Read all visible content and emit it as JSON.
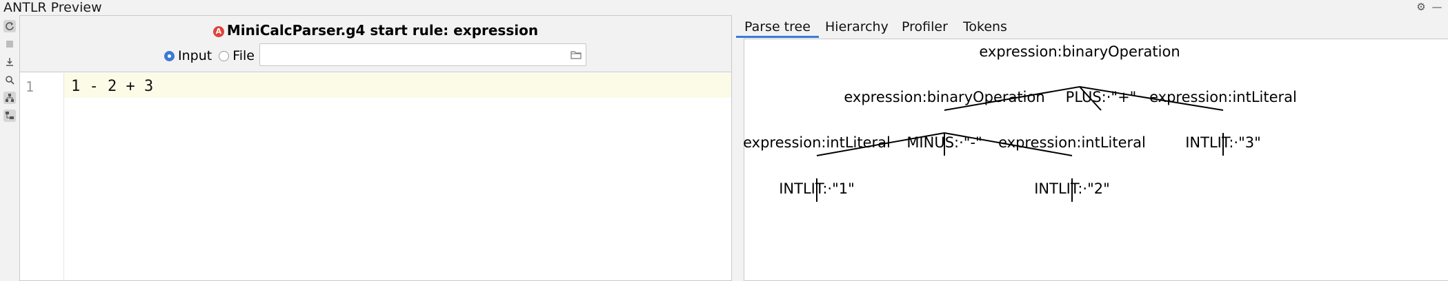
{
  "window": {
    "title": "ANTLR Preview",
    "title_icons": [
      "gear-icon",
      "minimize-icon"
    ]
  },
  "toolbar": {
    "tools": [
      "refresh-icon",
      "stop-icon",
      "export-icon",
      "find-icon",
      "tree-icon",
      "hierarchy-icon"
    ]
  },
  "header": {
    "grammar": "MiniCalcParser.g4 start rule: expression",
    "status_icon": "A",
    "input_label": "Input",
    "file_label": "File",
    "file_path": ""
  },
  "editor": {
    "line_number": "1",
    "code": "1 · 2 + 3",
    "code_display": "1 - 2 + 3"
  },
  "tabs": [
    {
      "label": "Parse tree",
      "active": true
    },
    {
      "label": "Hierarchy",
      "active": false
    },
    {
      "label": "Profiler",
      "active": false
    },
    {
      "label": "Tokens",
      "active": false
    }
  ],
  "parse_tree": {
    "nodes": {
      "root": "expression:binaryOperation",
      "left_op": "expression:binaryOperation",
      "plus": "PLUS:·\"+\"",
      "right_lit": "expression:intLiteral",
      "lit1": "expression:intLiteral",
      "minus": "MINUS:·\"-\"",
      "lit2": "expression:intLiteral",
      "int3": "INTLIT:·\"3\"",
      "int1": "INTLIT:·\"1\"",
      "int2": "INTLIT:·\"2\""
    }
  }
}
